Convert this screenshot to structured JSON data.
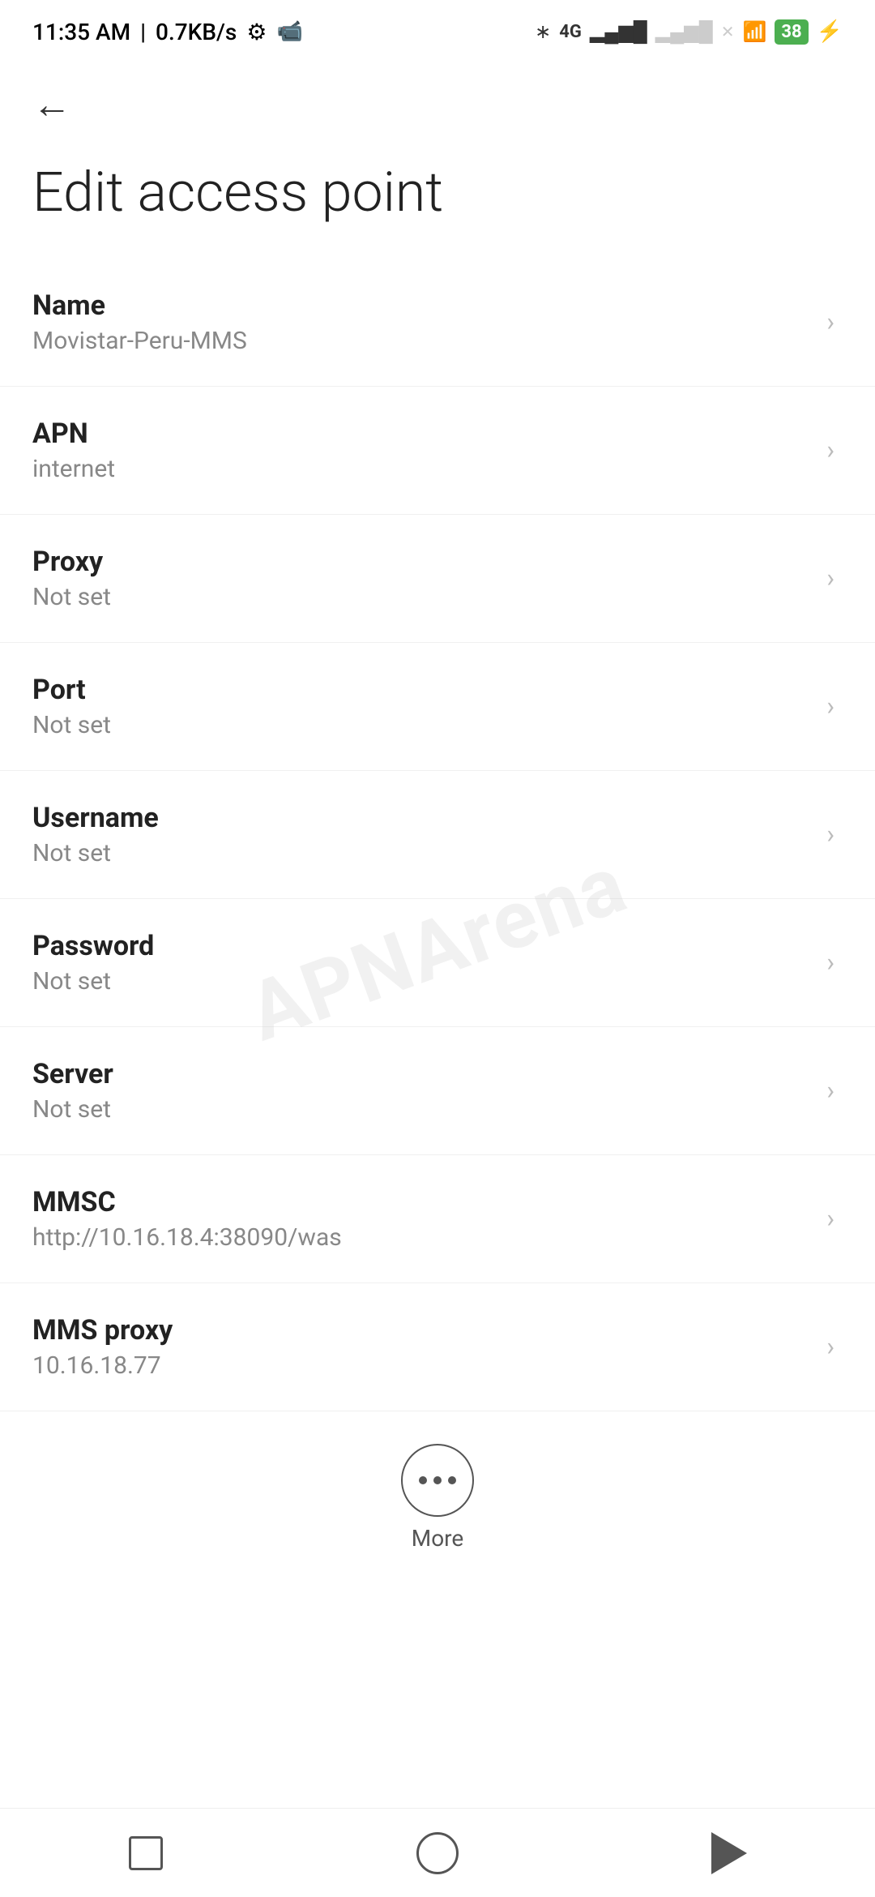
{
  "statusBar": {
    "time": "11:35 AM",
    "speed": "0.7KB/s"
  },
  "header": {
    "backLabel": "←",
    "title": "Edit access point"
  },
  "settings": [
    {
      "label": "Name",
      "value": "Movistar-Peru-MMS"
    },
    {
      "label": "APN",
      "value": "internet"
    },
    {
      "label": "Proxy",
      "value": "Not set"
    },
    {
      "label": "Port",
      "value": "Not set"
    },
    {
      "label": "Username",
      "value": "Not set"
    },
    {
      "label": "Password",
      "value": "Not set"
    },
    {
      "label": "Server",
      "value": "Not set"
    },
    {
      "label": "MMSC",
      "value": "http://10.16.18.4:38090/was"
    },
    {
      "label": "MMS proxy",
      "value": "10.16.18.77"
    }
  ],
  "more": {
    "label": "More"
  },
  "watermark": "APNArena"
}
